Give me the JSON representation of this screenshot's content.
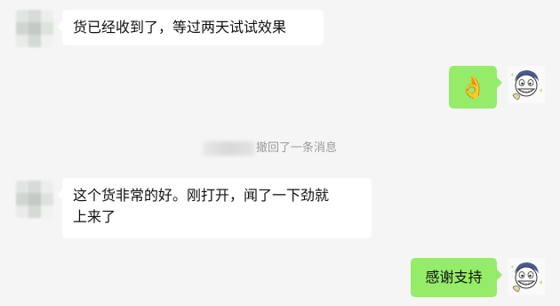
{
  "conversation": {
    "messages": [
      {
        "side": "left",
        "text": "货已经收到了，等过两天试试效果"
      },
      {
        "side": "right",
        "emoji": "👌"
      },
      {
        "side": "left",
        "text_line1": "这个货非常的好。刚打开，闻了一下劲就",
        "text_line2": "上来了"
      },
      {
        "side": "right",
        "text": "感谢支持"
      }
    ],
    "system_notice": "撤回了一条消息"
  },
  "colors": {
    "background": "#f5f5f5",
    "incoming_bubble": "#ffffff",
    "outgoing_bubble": "#95ec69",
    "notice_text": "#9a9a9a"
  }
}
